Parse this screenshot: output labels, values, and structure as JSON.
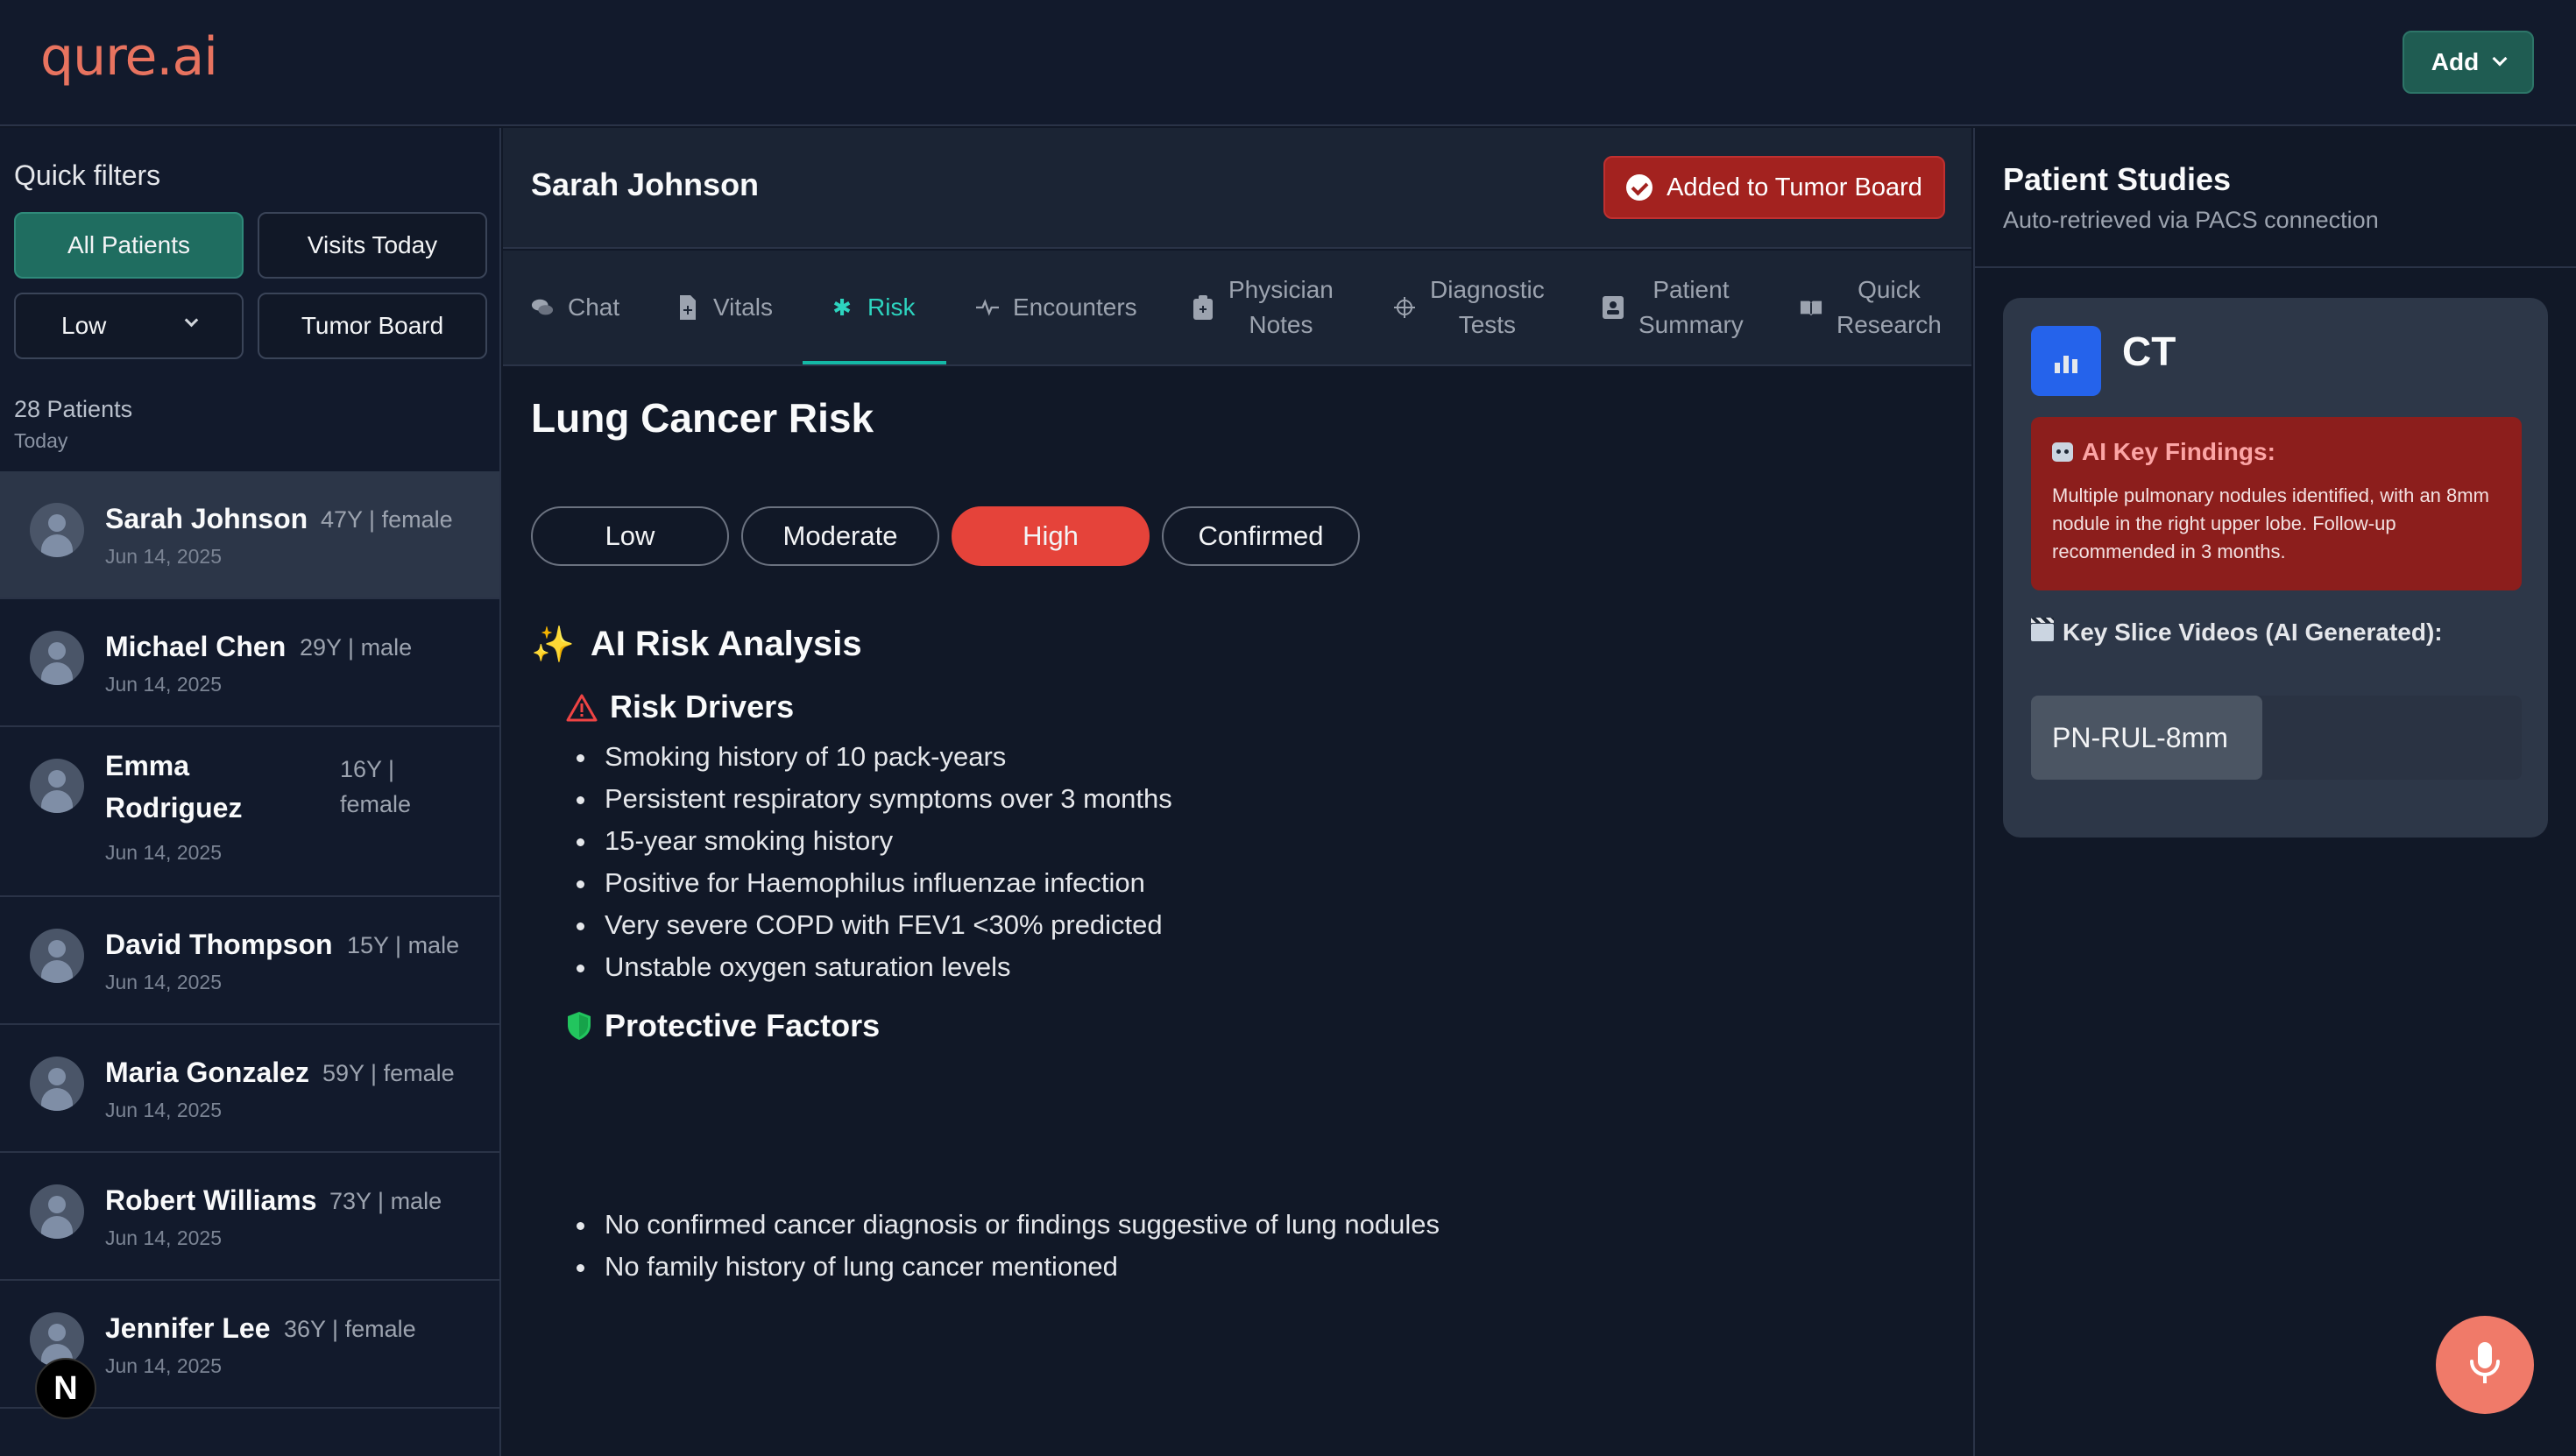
{
  "app": {
    "logo": "qure.ai",
    "add_label": "Add"
  },
  "colors": {
    "accent": "#1f6d60",
    "danger": "#a3221f",
    "high_risk": "#e5433a",
    "tab_active": "#2dd4bf",
    "mic": "#f07a69"
  },
  "sidebar": {
    "title": "Quick filters",
    "filters": {
      "all": "All Patients",
      "visits": "Visits Today",
      "risk": "Low",
      "tumor": "Tumor Board"
    },
    "count": "28 Patients",
    "count_sub": "Today",
    "patients": [
      {
        "name": "Sarah Johnson",
        "meta": "47Y | female",
        "date": "Jun 14, 2025"
      },
      {
        "name": "Michael Chen",
        "meta": "29Y | male",
        "date": "Jun 14, 2025"
      },
      {
        "name": "Emma Rodriguez",
        "meta": "16Y | female",
        "date": "Jun 14, 2025"
      },
      {
        "name": "David Thompson",
        "meta": "15Y | male",
        "date": "Jun 14, 2025"
      },
      {
        "name": "Maria Gonzalez",
        "meta": "59Y | female",
        "date": "Jun 14, 2025"
      },
      {
        "name": "Robert Williams",
        "meta": "73Y | male",
        "date": "Jun 14, 2025"
      },
      {
        "name": "Jennifer Lee",
        "meta": "36Y | female",
        "date": "Jun 14, 2025"
      }
    ],
    "badge": "N"
  },
  "main": {
    "patient_name": "Sarah Johnson",
    "tumor_board_label": "Added to Tumor Board",
    "tabs": [
      {
        "label": "Chat",
        "icon": "chat-icon"
      },
      {
        "label": "Vitals",
        "icon": "vitals-icon"
      },
      {
        "label": "Risk",
        "icon": "asterisk-icon"
      },
      {
        "label": "Encounters",
        "icon": "pulse-icon"
      },
      {
        "label": "Physician Notes",
        "line1": "Physician",
        "line2": "Notes",
        "icon": "clipboard-icon"
      },
      {
        "label": "Diagnostic Tests",
        "line1": "Diagnostic",
        "line2": "Tests",
        "icon": "crosshair-icon"
      },
      {
        "label": "Patient Summary",
        "line1": "Patient",
        "line2": "Summary",
        "icon": "id-card-icon"
      },
      {
        "label": "Quick Research",
        "line1": "Quick",
        "line2": "Research",
        "icon": "book-icon"
      }
    ],
    "active_tab": "Risk",
    "risk_title": "Lung Cancer Risk",
    "risk_levels": [
      "Low",
      "Moderate",
      "High",
      "Confirmed"
    ],
    "selected_risk": "High",
    "analysis_title": "AI Risk Analysis",
    "drivers_title": "Risk Drivers",
    "drivers": [
      "Smoking history of 10 pack-years",
      "Persistent respiratory symptoms over 3 months",
      "15-year smoking history",
      "Positive for Haemophilus influenzae infection",
      "Very severe COPD with FEV1 <30% predicted",
      "Unstable oxygen saturation levels"
    ],
    "protective_title": "Protective Factors",
    "protective": [
      "No confirmed cancer diagnosis or findings suggestive of lung nodules",
      "No family history of lung cancer mentioned"
    ]
  },
  "studies": {
    "title": "Patient Studies",
    "subtitle": "Auto-retrieved via PACS connection",
    "modality": "CT",
    "findings_title": "AI Key Findings:",
    "findings_text": "Multiple pulmonary nodules identified, with an 8mm nodule in the right upper lobe. Follow-up recommended in 3 months.",
    "videos_title": "Key Slice Videos (AI Generated):",
    "video_label": "PN-RUL-8mm"
  }
}
